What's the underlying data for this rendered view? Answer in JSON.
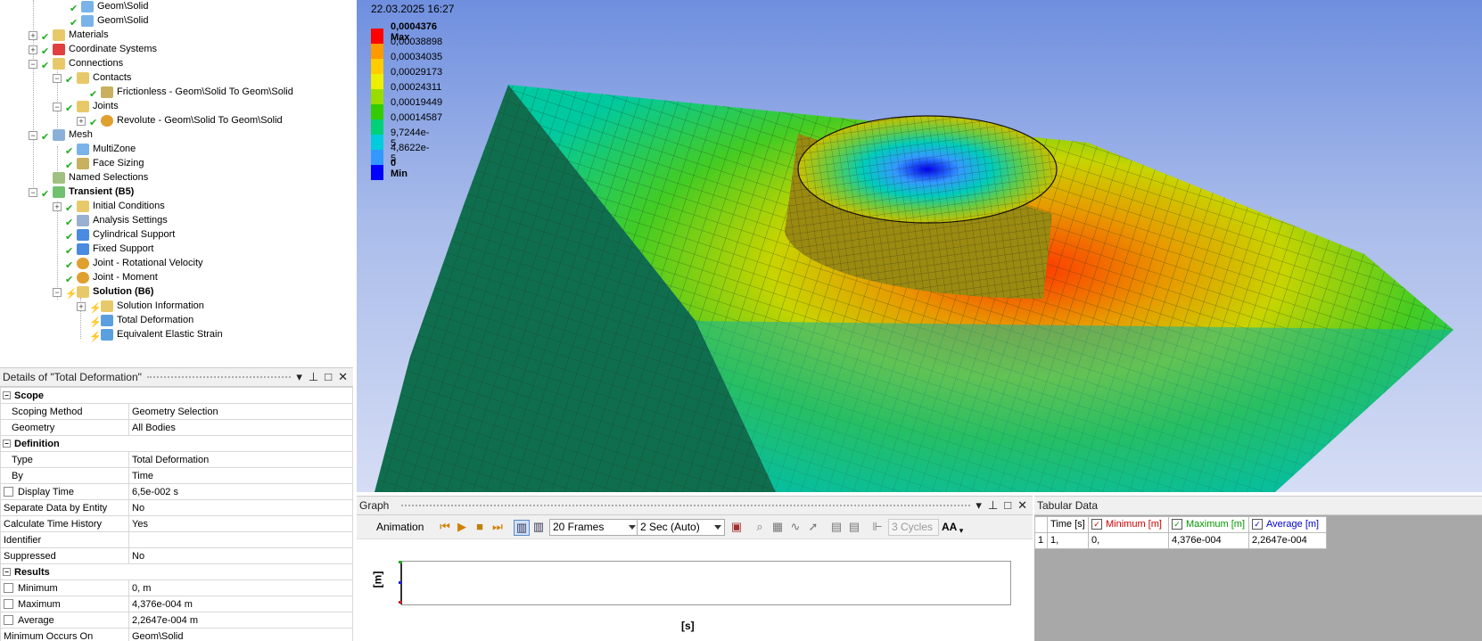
{
  "tree": {
    "nodes": [
      {
        "label": "Geom\\Solid",
        "bold": false,
        "icon": "solid-body-icon"
      },
      {
        "label": "Geom\\Solid",
        "bold": false,
        "icon": "solid-body-icon"
      },
      {
        "label": "Materials",
        "bold": false,
        "icon": "materials-folder-icon"
      },
      {
        "label": "Coordinate Systems",
        "bold": false,
        "icon": "coordinate-systems-icon"
      },
      {
        "label": "Connections",
        "bold": false,
        "icon": "connections-folder-icon"
      },
      {
        "label": "Contacts",
        "bold": false,
        "icon": "contacts-folder-icon"
      },
      {
        "label": "Frictionless - Geom\\Solid To Geom\\Solid",
        "bold": false,
        "icon": "contact-region-icon"
      },
      {
        "label": "Joints",
        "bold": false,
        "icon": "joints-folder-icon"
      },
      {
        "label": "Revolute - Geom\\Solid To Geom\\Solid",
        "bold": false,
        "icon": "revolute-joint-icon"
      },
      {
        "label": "Mesh",
        "bold": false,
        "icon": "mesh-icon"
      },
      {
        "label": "MultiZone",
        "bold": false,
        "icon": "multizone-icon"
      },
      {
        "label": "Face Sizing",
        "bold": false,
        "icon": "face-sizing-icon"
      },
      {
        "label": "Named Selections",
        "bold": false,
        "icon": "named-selections-icon"
      },
      {
        "label": "Transient (B5)",
        "bold": true,
        "icon": "transient-analysis-icon"
      },
      {
        "label": "Initial Conditions",
        "bold": false,
        "icon": "initial-conditions-icon"
      },
      {
        "label": "Analysis Settings",
        "bold": false,
        "icon": "analysis-settings-icon"
      },
      {
        "label": "Cylindrical Support",
        "bold": false,
        "icon": "cylindrical-support-icon"
      },
      {
        "label": "Fixed Support",
        "bold": false,
        "icon": "fixed-support-icon"
      },
      {
        "label": "Joint - Rotational Velocity",
        "bold": false,
        "icon": "joint-load-icon"
      },
      {
        "label": "Joint - Moment",
        "bold": false,
        "icon": "joint-load-icon"
      },
      {
        "label": "Solution (B6)",
        "bold": true,
        "icon": "solution-icon"
      },
      {
        "label": "Solution Information",
        "bold": false,
        "icon": "solution-information-icon"
      },
      {
        "label": "Total Deformation",
        "bold": false,
        "icon": "result-icon"
      },
      {
        "label": "Equivalent Elastic Strain",
        "bold": false,
        "icon": "result-icon"
      }
    ]
  },
  "details": {
    "title": "Details of \"Total Deformation\"",
    "sections": [
      {
        "name": "Scope",
        "rows": [
          {
            "key": "Scoping Method",
            "value": "Geometry Selection",
            "checkbox": false
          },
          {
            "key": "Geometry",
            "value": "All Bodies",
            "checkbox": false
          }
        ]
      },
      {
        "name": "Definition",
        "rows": [
          {
            "key": "Type",
            "value": "Total Deformation",
            "checkbox": false
          },
          {
            "key": "By",
            "value": "Time",
            "checkbox": false
          },
          {
            "key": "Display Time",
            "value": "6,5e-002 s",
            "checkbox": true
          },
          {
            "key": "Separate Data by Entity",
            "value": "No",
            "checkbox": false
          },
          {
            "key": "Calculate Time History",
            "value": "Yes",
            "checkbox": false
          },
          {
            "key": "Identifier",
            "value": "",
            "checkbox": false
          },
          {
            "key": "Suppressed",
            "value": "No",
            "checkbox": false
          }
        ]
      },
      {
        "name": "Results",
        "rows": [
          {
            "key": "Minimum",
            "value": "0, m",
            "checkbox": true
          },
          {
            "key": "Maximum",
            "value": "4,376e-004 m",
            "checkbox": true
          },
          {
            "key": "Average",
            "value": "2,2647e-004 m",
            "checkbox": true
          },
          {
            "key": "Minimum Occurs On",
            "value": "Geom\\Solid",
            "checkbox": false
          }
        ]
      }
    ]
  },
  "viewport": {
    "datetime": "22.03.2025 16:27",
    "legend": [
      {
        "label": "0,0004376 Max",
        "bold": true
      },
      {
        "label": "0,00038898",
        "bold": false
      },
      {
        "label": "0,00034035",
        "bold": false
      },
      {
        "label": "0,00029173",
        "bold": false
      },
      {
        "label": "0,00024311",
        "bold": false
      },
      {
        "label": "0,00019449",
        "bold": false
      },
      {
        "label": "0,00014587",
        "bold": false
      },
      {
        "label": "9,7244e-5",
        "bold": false
      },
      {
        "label": "4,8622e-5",
        "bold": false
      },
      {
        "label": "0 Min",
        "bold": true
      }
    ],
    "legend_colors": [
      "#ff0000",
      "#ff9900",
      "#ffcc00",
      "#eeee00",
      "#99dd00",
      "#33cc00",
      "#00d177",
      "#00ccdd",
      "#3399ff",
      "#0000ff"
    ]
  },
  "graph": {
    "title": "Graph",
    "animation_label": "Animation",
    "frames": "20 Frames",
    "duration": "2 Sec (Auto)",
    "cycles": "3 Cycles",
    "aa": "AA",
    "yaxis_label": "[m]",
    "xaxis_label": "[s]"
  },
  "tabular": {
    "title": "Tabular Data",
    "headers": [
      "Time [s]",
      "Minimum [m]",
      "Maximum [m]",
      "Average [m]"
    ],
    "header_colors": [
      "#000000",
      "#cc0000",
      "#009900",
      "#0000cc"
    ],
    "rows": [
      {
        "index": "1",
        "cells": [
          "1,",
          "0,",
          "4,376e-004",
          "2,2647e-004"
        ]
      }
    ]
  }
}
